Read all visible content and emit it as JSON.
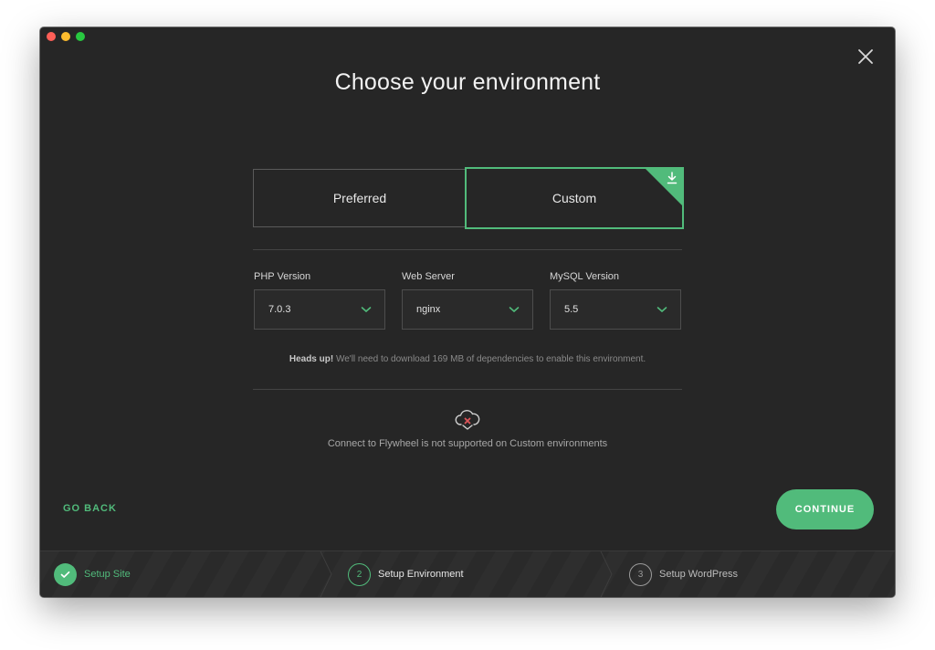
{
  "window": {
    "title": "Choose your environment"
  },
  "environment": {
    "options": [
      {
        "label": "Preferred"
      },
      {
        "label": "Custom"
      }
    ],
    "selected": "Custom",
    "accent_color": "#51bb7b"
  },
  "fields": [
    {
      "label": "PHP Version",
      "value": "7.0.3"
    },
    {
      "label": "Web Server",
      "value": "nginx"
    },
    {
      "label": "MySQL Version",
      "value": "5.5"
    }
  ],
  "note": {
    "bold": "Heads up!",
    "text": " We'll need to download 169 MB of dependencies to enable this environment."
  },
  "flywheel": {
    "icon": "cloud-error-icon",
    "text": "Connect to Flywheel is not supported on Custom environments"
  },
  "actions": {
    "go_back": "GO BACK",
    "continue": "CONTINUE"
  },
  "steps": [
    {
      "number": "1",
      "label": "Setup Site",
      "status": "complete"
    },
    {
      "number": "2",
      "label": "Setup Environment",
      "status": "current"
    },
    {
      "number": "3",
      "label": "Setup WordPress",
      "status": "upcoming"
    }
  ]
}
